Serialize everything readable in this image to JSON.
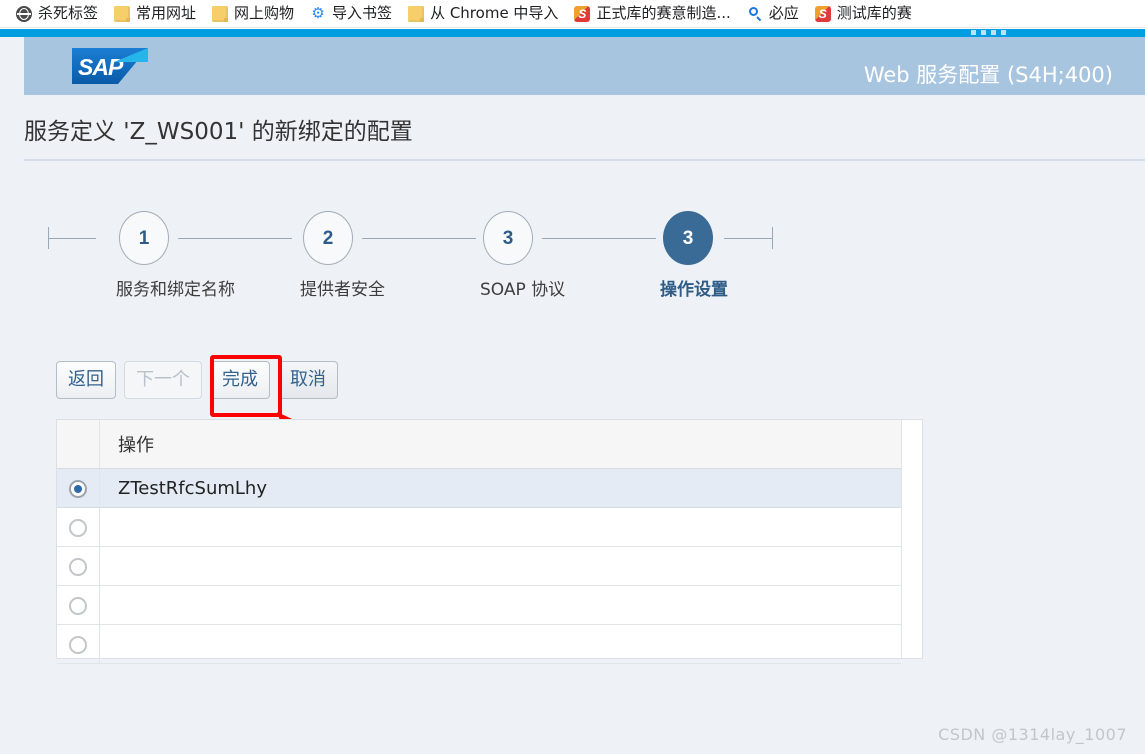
{
  "browser": {
    "bookmarks": [
      {
        "label": "杀死标签",
        "icon": "globe-icon"
      },
      {
        "label": "常用网址",
        "icon": "folder-icon"
      },
      {
        "label": "网上购物",
        "icon": "folder-icon"
      },
      {
        "label": "导入书签",
        "icon": "gear-icon"
      },
      {
        "label": "从 Chrome 中导入",
        "icon": "folder-icon"
      },
      {
        "label": "正式库的赛意制造...",
        "icon": "sap-shortcut-icon"
      },
      {
        "label": "必应",
        "icon": "search-icon"
      },
      {
        "label": "测试库的赛",
        "icon": "sap-shortcut-icon"
      }
    ]
  },
  "shell": {
    "logo_text": "SAP",
    "app_title": "Web 服务配置 (S4H;400)",
    "accent_color": "#009de0",
    "header_band_color": "#a8c5e0"
  },
  "page": {
    "title": "服务定义 'Z_WS001' 的新绑定的配置"
  },
  "roadmap": {
    "steps": [
      {
        "number": "1",
        "label": "服务和绑定名称",
        "active": false
      },
      {
        "number": "2",
        "label": "提供者安全",
        "active": false
      },
      {
        "number": "3",
        "label": "SOAP 协议",
        "active": false
      },
      {
        "number": "3",
        "label": "操作设置",
        "active": true
      }
    ],
    "active_color": "#3a6b96"
  },
  "toolbar": {
    "back_label": "返回",
    "next_label": "下一个",
    "finish_label": "完成",
    "cancel_label": "取消"
  },
  "annotation": {
    "highlight_color": "#ff0000",
    "highlight_target": "完成"
  },
  "table": {
    "columns": [
      "",
      "操作"
    ],
    "rows": [
      {
        "selected": true,
        "operation": "ZTestRfcSumLhy"
      },
      {
        "selected": false,
        "operation": ""
      },
      {
        "selected": false,
        "operation": ""
      },
      {
        "selected": false,
        "operation": ""
      },
      {
        "selected": false,
        "operation": ""
      }
    ]
  },
  "watermark": {
    "text": "CSDN @1314lay_1007"
  }
}
